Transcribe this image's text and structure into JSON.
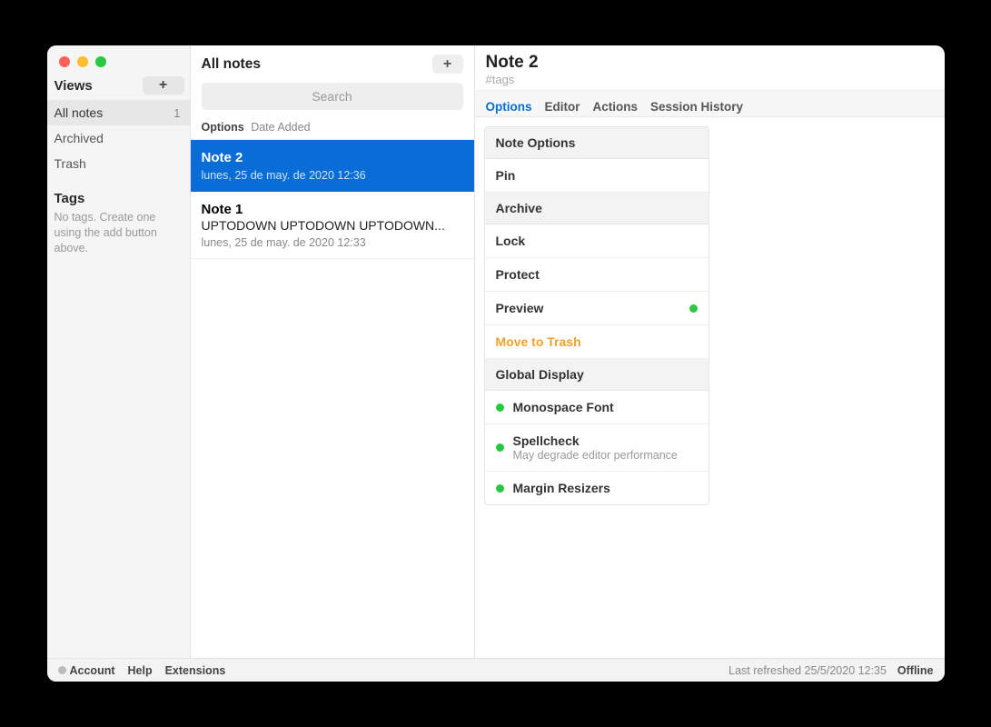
{
  "sidebar": {
    "views_heading": "Views",
    "items": [
      {
        "label": "All notes",
        "count": "1",
        "active": true
      },
      {
        "label": "Archived"
      },
      {
        "label": "Trash"
      }
    ],
    "tags_heading": "Tags",
    "tags_empty": "No tags. Create one using the add button above."
  },
  "notes": {
    "title": "All notes",
    "search_placeholder": "Search",
    "sort": {
      "label": "Options",
      "mode": "Date Added"
    },
    "items": [
      {
        "title": "Note 2",
        "preview": "",
        "date": "lunes, 25 de may. de 2020 12:36",
        "selected": true
      },
      {
        "title": "Note 1",
        "preview": "UPTODOWN UPTODOWN UPTODOWN...",
        "date": "lunes, 25 de may. de 2020 12:33",
        "selected": false
      }
    ]
  },
  "detail": {
    "title": "Note 2",
    "tags_placeholder": "#tags",
    "tabs": [
      "Options",
      "Editor",
      "Actions",
      "Session History"
    ],
    "active_tab": "Options",
    "panel": {
      "note_options_header": "Note Options",
      "pin": "Pin",
      "archive": "Archive",
      "lock": "Lock",
      "protect": "Protect",
      "preview": "Preview",
      "move_to_trash": "Move to Trash",
      "global_display_header": "Global Display",
      "monospace": "Monospace Font",
      "spellcheck": "Spellcheck",
      "spellcheck_sub": "May degrade editor performance",
      "margin_resizers": "Margin Resizers"
    }
  },
  "footer": {
    "account": "Account",
    "help": "Help",
    "extensions": "Extensions",
    "last_refreshed": "Last refreshed 25/5/2020 12:35",
    "status": "Offline"
  }
}
